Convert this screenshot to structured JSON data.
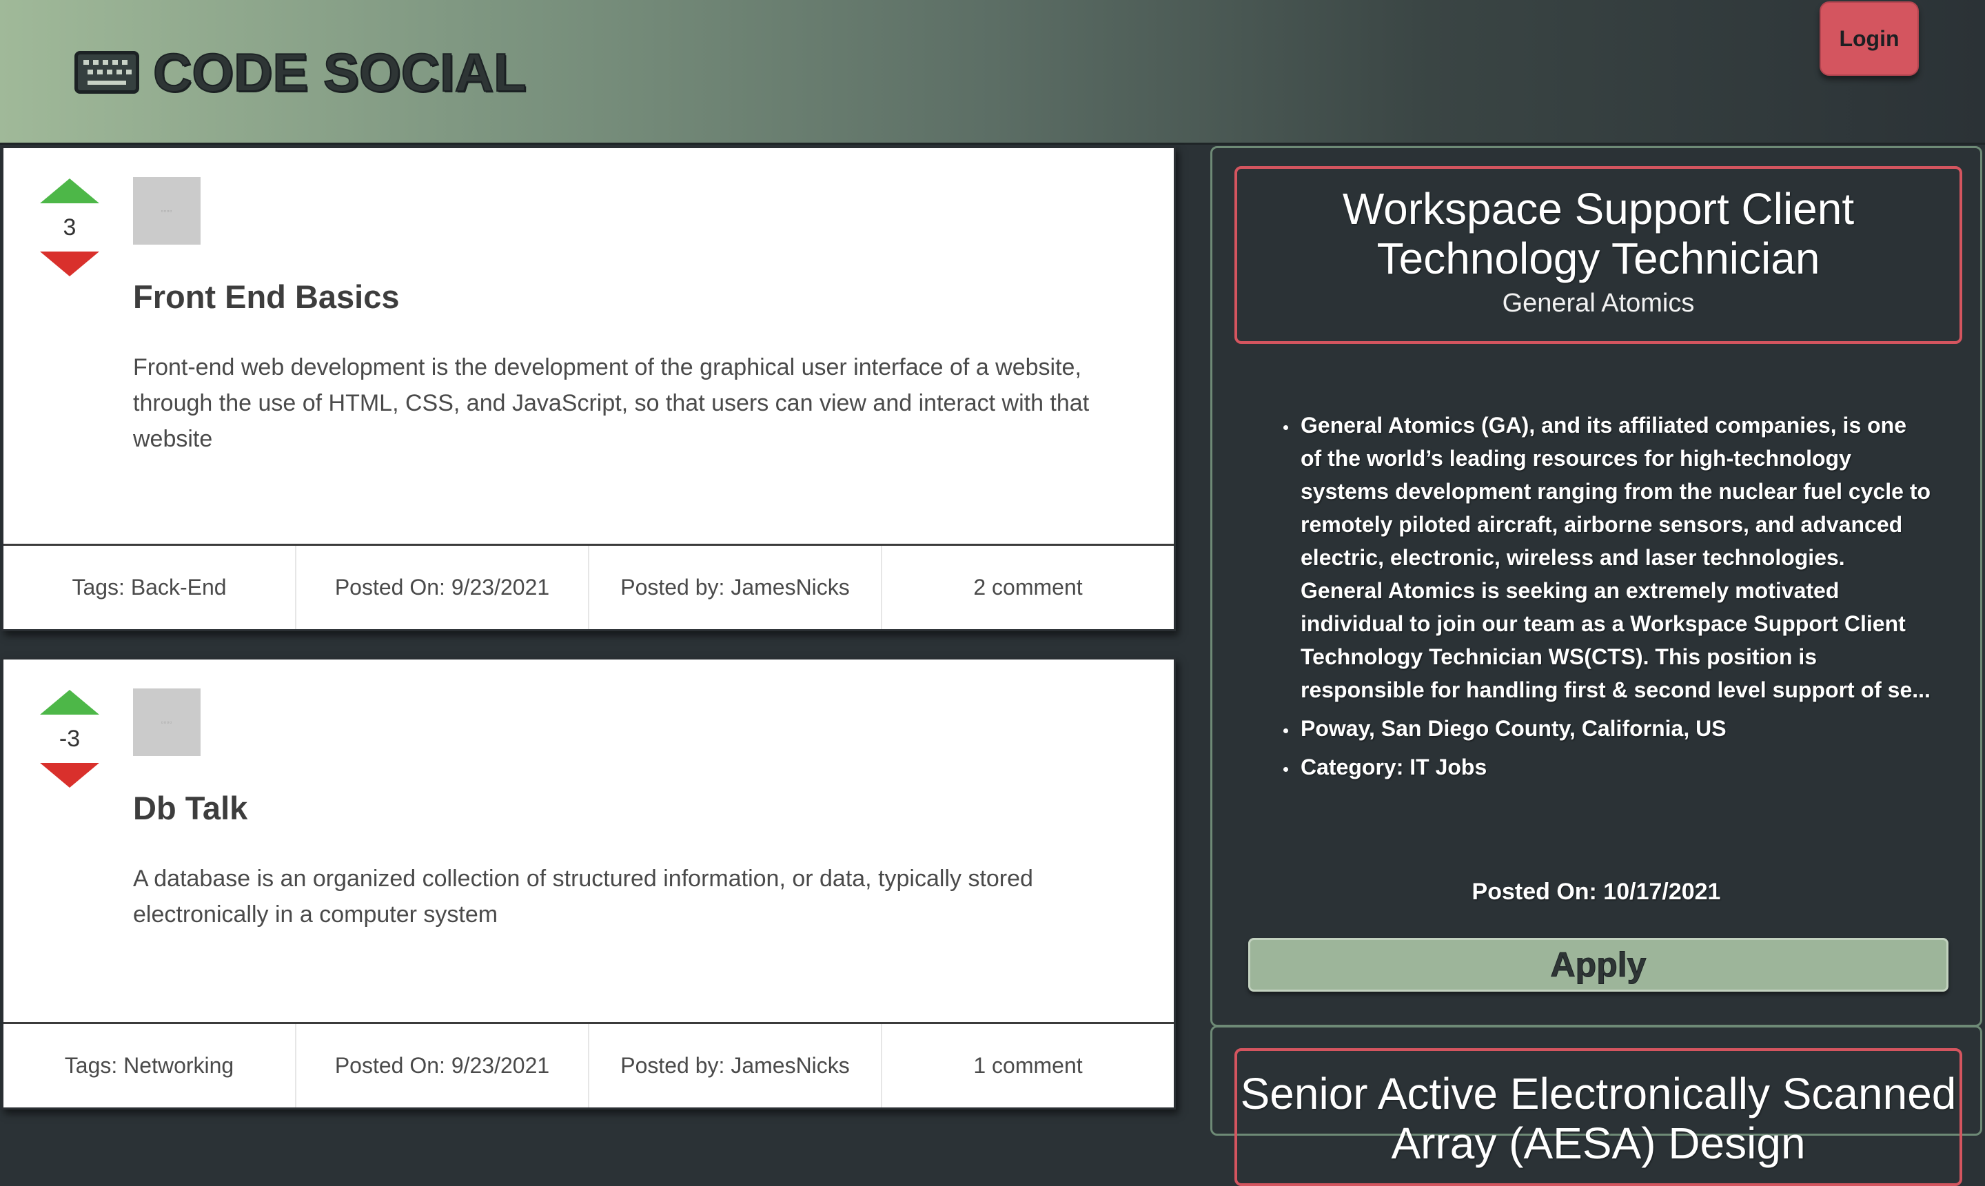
{
  "header": {
    "brand_icon": "keyboard-icon",
    "brand_title": "CODE SOCIAL",
    "login_label": "Login"
  },
  "posts": [
    {
      "score": "3",
      "title": "Front End Basics",
      "body": "Front-end web development is the development of the graphical user interface of a website, through the use of HTML, CSS, and JavaScript, so that users can view and interact with that website",
      "tags": "Tags: Back-End",
      "posted_on": "Posted On: 9/23/2021",
      "posted_by": "Posted by: JamesNicks",
      "comments": "2 comment"
    },
    {
      "score": "-3",
      "title": "Db Talk",
      "body": "A database is an organized collection of structured information, or data, typically stored electronically in a computer system",
      "tags": "Tags: Networking",
      "posted_on": "Posted On: 9/23/2021",
      "posted_by": "Posted by: JamesNicks",
      "comments": "1 comment"
    }
  ],
  "jobs": [
    {
      "title": "Workspace Support Client Technology Technician",
      "company": "General Atomics",
      "details": [
        "General Atomics (GA), and its affiliated companies, is one of the world’s leading resources for high-technology systems development ranging from the nuclear fuel cycle to remotely piloted aircraft, airborne sensors, and advanced electric, electronic, wireless and laser technologies. General Atomics is seeking an extremely motivated individual to join our team as a Workspace Support Client Technology Technician WS(CTS). This position is responsible for handling first & second level support of se...",
        "Poway, San Diego County, California, US",
        "Category: IT Jobs"
      ],
      "posted_on": "Posted On: 10/17/2021",
      "apply_label": "Apply"
    },
    {
      "title": "Senior Active Electronically Scanned Array (AESA) Design"
    }
  ],
  "colors": {
    "upvote": "#4db748",
    "downvote": "#d9302c",
    "login": "#d4555f",
    "apply": "#9db59a",
    "panel_bg": "#2b3236"
  }
}
